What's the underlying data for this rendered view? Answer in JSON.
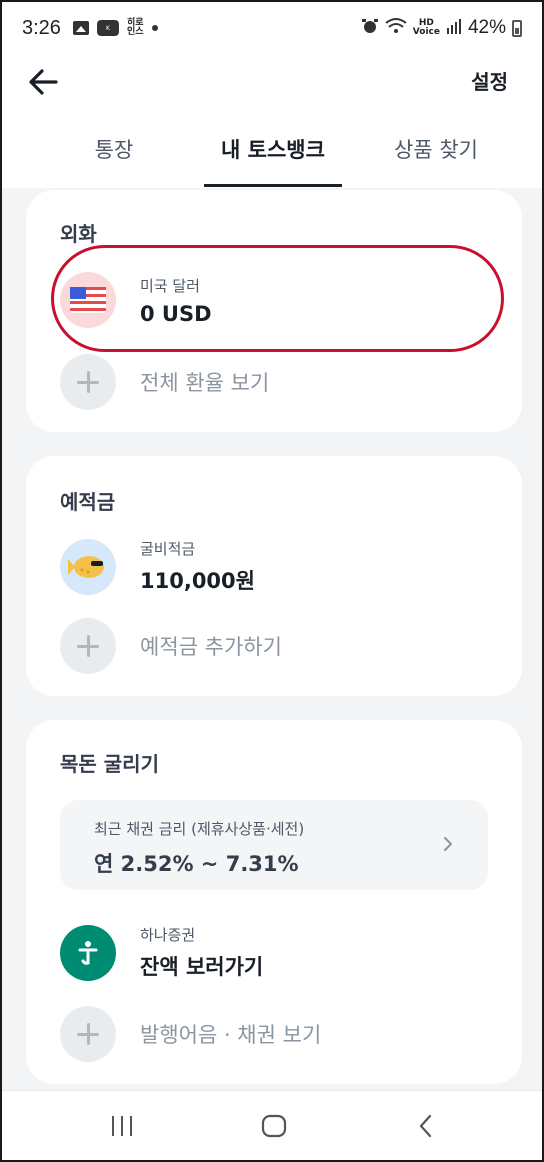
{
  "status_bar": {
    "time": "3:26",
    "notif_text": "히로\n인스",
    "hd_text": "HD\nVoice",
    "battery": "42%"
  },
  "header": {
    "settings_label": "설정"
  },
  "tabs": [
    {
      "label": "통장",
      "active": false
    },
    {
      "label": "내 토스뱅크",
      "active": true
    },
    {
      "label": "상품 찾기",
      "active": false
    }
  ],
  "foreign_currency": {
    "title": "외화",
    "account_name": "미국 달러",
    "balance": "0 USD",
    "add_label": "전체 환율 보기"
  },
  "savings": {
    "title": "예적금",
    "account_name": "굴비적금",
    "balance": "110,000원",
    "add_label": "예적금 추가하기"
  },
  "lump_sum": {
    "title": "목돈 굴리기",
    "rate_subtitle": "최근 채권 금리 (제휴사상품·세전)",
    "rate_value": "연 2.52% ~ 7.31%",
    "broker_name": "하나증권",
    "broker_action": "잔액 보러가기",
    "add_label": "발행어음 · 채권 보기"
  },
  "colors": {
    "highlight": "#c8102e",
    "hana_green": "#008c73"
  }
}
